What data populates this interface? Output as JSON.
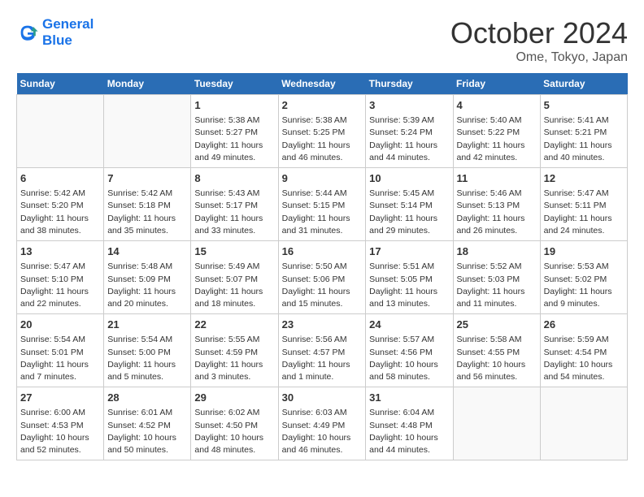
{
  "header": {
    "logo_line1": "General",
    "logo_line2": "Blue",
    "month_title": "October 2024",
    "location": "Ome, Tokyo, Japan"
  },
  "weekdays": [
    "Sunday",
    "Monday",
    "Tuesday",
    "Wednesday",
    "Thursday",
    "Friday",
    "Saturday"
  ],
  "weeks": [
    [
      {
        "day": null,
        "info": null
      },
      {
        "day": null,
        "info": null
      },
      {
        "day": "1",
        "sunrise": "Sunrise: 5:38 AM",
        "sunset": "Sunset: 5:27 PM",
        "daylight": "Daylight: 11 hours and 49 minutes."
      },
      {
        "day": "2",
        "sunrise": "Sunrise: 5:38 AM",
        "sunset": "Sunset: 5:25 PM",
        "daylight": "Daylight: 11 hours and 46 minutes."
      },
      {
        "day": "3",
        "sunrise": "Sunrise: 5:39 AM",
        "sunset": "Sunset: 5:24 PM",
        "daylight": "Daylight: 11 hours and 44 minutes."
      },
      {
        "day": "4",
        "sunrise": "Sunrise: 5:40 AM",
        "sunset": "Sunset: 5:22 PM",
        "daylight": "Daylight: 11 hours and 42 minutes."
      },
      {
        "day": "5",
        "sunrise": "Sunrise: 5:41 AM",
        "sunset": "Sunset: 5:21 PM",
        "daylight": "Daylight: 11 hours and 40 minutes."
      }
    ],
    [
      {
        "day": "6",
        "sunrise": "Sunrise: 5:42 AM",
        "sunset": "Sunset: 5:20 PM",
        "daylight": "Daylight: 11 hours and 38 minutes."
      },
      {
        "day": "7",
        "sunrise": "Sunrise: 5:42 AM",
        "sunset": "Sunset: 5:18 PM",
        "daylight": "Daylight: 11 hours and 35 minutes."
      },
      {
        "day": "8",
        "sunrise": "Sunrise: 5:43 AM",
        "sunset": "Sunset: 5:17 PM",
        "daylight": "Daylight: 11 hours and 33 minutes."
      },
      {
        "day": "9",
        "sunrise": "Sunrise: 5:44 AM",
        "sunset": "Sunset: 5:15 PM",
        "daylight": "Daylight: 11 hours and 31 minutes."
      },
      {
        "day": "10",
        "sunrise": "Sunrise: 5:45 AM",
        "sunset": "Sunset: 5:14 PM",
        "daylight": "Daylight: 11 hours and 29 minutes."
      },
      {
        "day": "11",
        "sunrise": "Sunrise: 5:46 AM",
        "sunset": "Sunset: 5:13 PM",
        "daylight": "Daylight: 11 hours and 26 minutes."
      },
      {
        "day": "12",
        "sunrise": "Sunrise: 5:47 AM",
        "sunset": "Sunset: 5:11 PM",
        "daylight": "Daylight: 11 hours and 24 minutes."
      }
    ],
    [
      {
        "day": "13",
        "sunrise": "Sunrise: 5:47 AM",
        "sunset": "Sunset: 5:10 PM",
        "daylight": "Daylight: 11 hours and 22 minutes."
      },
      {
        "day": "14",
        "sunrise": "Sunrise: 5:48 AM",
        "sunset": "Sunset: 5:09 PM",
        "daylight": "Daylight: 11 hours and 20 minutes."
      },
      {
        "day": "15",
        "sunrise": "Sunrise: 5:49 AM",
        "sunset": "Sunset: 5:07 PM",
        "daylight": "Daylight: 11 hours and 18 minutes."
      },
      {
        "day": "16",
        "sunrise": "Sunrise: 5:50 AM",
        "sunset": "Sunset: 5:06 PM",
        "daylight": "Daylight: 11 hours and 15 minutes."
      },
      {
        "day": "17",
        "sunrise": "Sunrise: 5:51 AM",
        "sunset": "Sunset: 5:05 PM",
        "daylight": "Daylight: 11 hours and 13 minutes."
      },
      {
        "day": "18",
        "sunrise": "Sunrise: 5:52 AM",
        "sunset": "Sunset: 5:03 PM",
        "daylight": "Daylight: 11 hours and 11 minutes."
      },
      {
        "day": "19",
        "sunrise": "Sunrise: 5:53 AM",
        "sunset": "Sunset: 5:02 PM",
        "daylight": "Daylight: 11 hours and 9 minutes."
      }
    ],
    [
      {
        "day": "20",
        "sunrise": "Sunrise: 5:54 AM",
        "sunset": "Sunset: 5:01 PM",
        "daylight": "Daylight: 11 hours and 7 minutes."
      },
      {
        "day": "21",
        "sunrise": "Sunrise: 5:54 AM",
        "sunset": "Sunset: 5:00 PM",
        "daylight": "Daylight: 11 hours and 5 minutes."
      },
      {
        "day": "22",
        "sunrise": "Sunrise: 5:55 AM",
        "sunset": "Sunset: 4:59 PM",
        "daylight": "Daylight: 11 hours and 3 minutes."
      },
      {
        "day": "23",
        "sunrise": "Sunrise: 5:56 AM",
        "sunset": "Sunset: 4:57 PM",
        "daylight": "Daylight: 11 hours and 1 minute."
      },
      {
        "day": "24",
        "sunrise": "Sunrise: 5:57 AM",
        "sunset": "Sunset: 4:56 PM",
        "daylight": "Daylight: 10 hours and 58 minutes."
      },
      {
        "day": "25",
        "sunrise": "Sunrise: 5:58 AM",
        "sunset": "Sunset: 4:55 PM",
        "daylight": "Daylight: 10 hours and 56 minutes."
      },
      {
        "day": "26",
        "sunrise": "Sunrise: 5:59 AM",
        "sunset": "Sunset: 4:54 PM",
        "daylight": "Daylight: 10 hours and 54 minutes."
      }
    ],
    [
      {
        "day": "27",
        "sunrise": "Sunrise: 6:00 AM",
        "sunset": "Sunset: 4:53 PM",
        "daylight": "Daylight: 10 hours and 52 minutes."
      },
      {
        "day": "28",
        "sunrise": "Sunrise: 6:01 AM",
        "sunset": "Sunset: 4:52 PM",
        "daylight": "Daylight: 10 hours and 50 minutes."
      },
      {
        "day": "29",
        "sunrise": "Sunrise: 6:02 AM",
        "sunset": "Sunset: 4:50 PM",
        "daylight": "Daylight: 10 hours and 48 minutes."
      },
      {
        "day": "30",
        "sunrise": "Sunrise: 6:03 AM",
        "sunset": "Sunset: 4:49 PM",
        "daylight": "Daylight: 10 hours and 46 minutes."
      },
      {
        "day": "31",
        "sunrise": "Sunrise: 6:04 AM",
        "sunset": "Sunset: 4:48 PM",
        "daylight": "Daylight: 10 hours and 44 minutes."
      },
      {
        "day": null,
        "info": null
      },
      {
        "day": null,
        "info": null
      }
    ]
  ]
}
